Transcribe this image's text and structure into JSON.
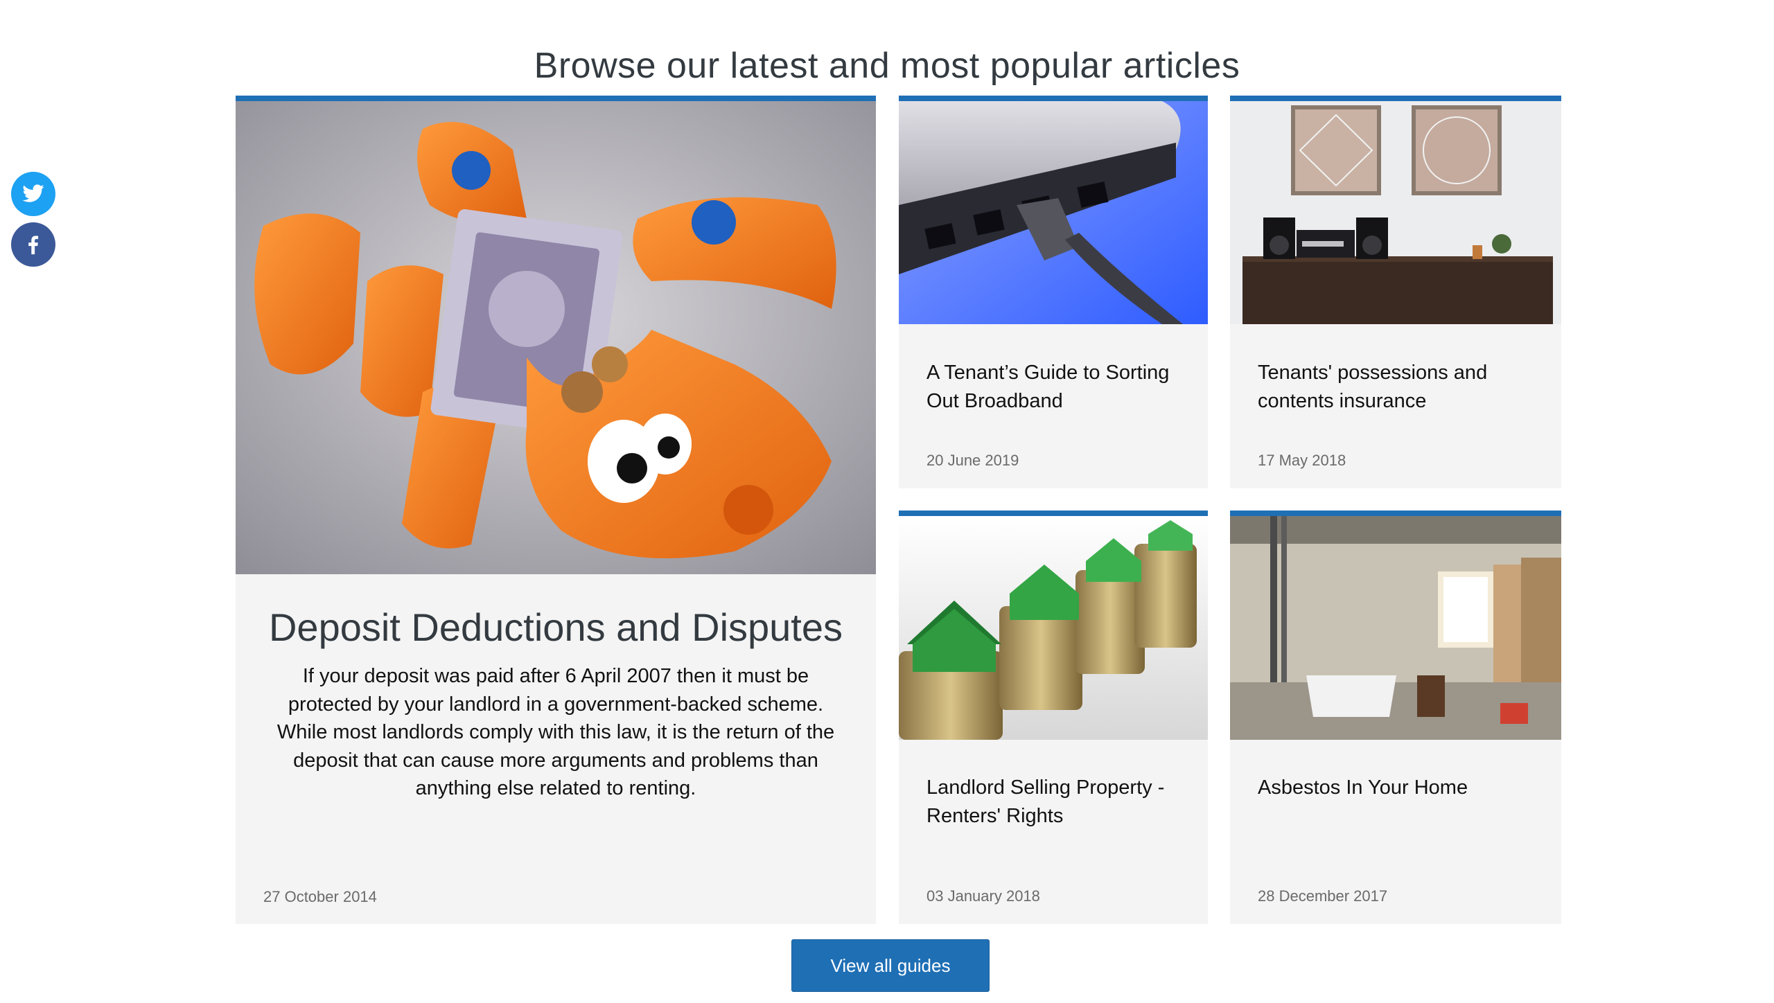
{
  "header": {
    "title": "Browse our latest and most popular articles"
  },
  "social": {
    "icons": [
      "twitter-icon",
      "facebook-icon"
    ]
  },
  "articles": {
    "featured": {
      "title": "Deposit Deductions and Disputes",
      "excerpt": "If your deposit was paid after 6 April 2007 then it must be protected by your landlord in a government-backed scheme. While most landlords comply with this law, it is the return of the deposit that can cause more arguments and problems than anything else related to renting.",
      "date": "27 October 2014"
    },
    "broadband": {
      "title": "A Tenant’s Guide to Sorting Out Broadband",
      "date": "20 June 2019"
    },
    "insurance": {
      "title": "Tenants' possessions and contents insurance",
      "date": "17 May 2018"
    },
    "selling": {
      "title": "Landlord Selling Property - Renters' Rights",
      "date": "03 January 2018"
    },
    "asbestos": {
      "title": "Asbestos In Your Home",
      "date": "28 December 2017"
    }
  },
  "footer": {
    "view_all_label": "View all guides"
  },
  "colors": {
    "accent": "#1f6fb5",
    "card_bg": "#f4f4f4",
    "twitter": "#1da1f2",
    "facebook": "#3b5998"
  }
}
